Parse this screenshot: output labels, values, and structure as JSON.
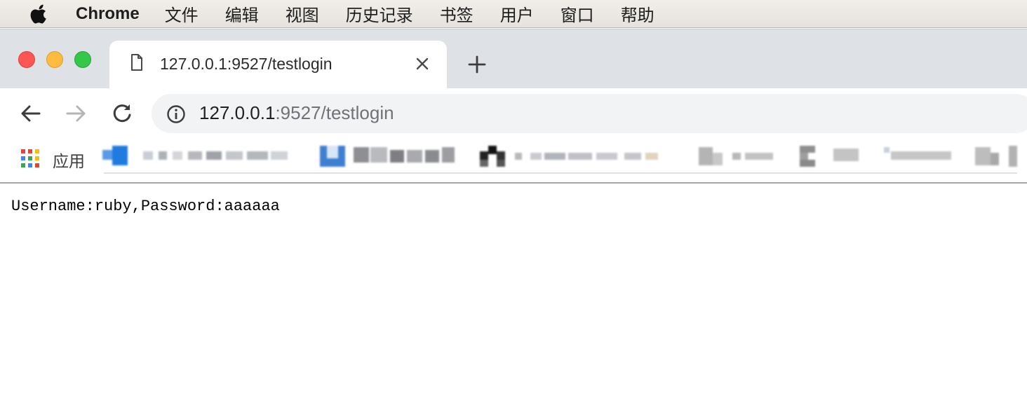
{
  "menubar": {
    "app_name": "Chrome",
    "items": [
      "文件",
      "编辑",
      "视图",
      "历史记录",
      "书签",
      "用户",
      "窗口",
      "帮助"
    ]
  },
  "tab": {
    "title": "127.0.0.1:9527/testlogin"
  },
  "omnibox": {
    "host": "127.0.0.1",
    "path": ":9527/testlogin"
  },
  "bookmarks": {
    "apps_label": "应用"
  },
  "page": {
    "text": "Username:ruby,Password:aaaaaa"
  },
  "colors": {
    "close": "#fc5753",
    "minimize": "#fdbc40",
    "maximize": "#34c748",
    "tabstrip": "#dee1e6",
    "omnibox": "#f1f3f4"
  }
}
